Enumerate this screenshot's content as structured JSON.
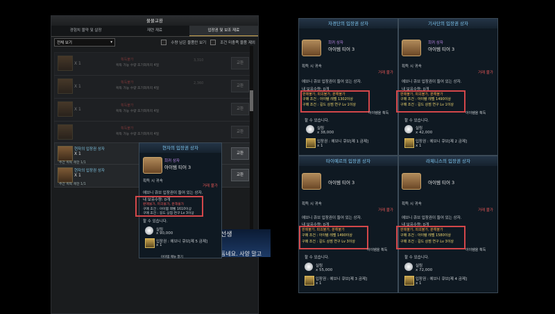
{
  "left": {
    "window_title": "물물교환",
    "tabs": [
      "경험치 물약 및 살장",
      "재련 재료",
      "입장권 및 보조 재료"
    ],
    "filter": {
      "dropdown": "전체 보기",
      "chk1": "수량 남은 물품만 보기",
      "chk2": "조건 미충족 물품 제외"
    },
    "rows": [
      {
        "na": "획득불가",
        "cond": "획득 가능 수량 초기화까지 4일",
        "qty": "3,310",
        "btn": "교환"
      },
      {
        "na": "획득불가",
        "cond": "획득 가능 수량 초기화까지 4일",
        "qty": "2,360",
        "btn": "교환"
      },
      {
        "na": "획득불가",
        "cond": "획득 가능 수량 초기화까지 4일",
        "qty": "",
        "btn": "교환"
      },
      {
        "na": "획득불가",
        "cond": "획득 가능 수량 초기화까지 4일",
        "qty": "",
        "btn": "교환"
      },
      {
        "name": "현자의 입장권 상자",
        "count": "X 1",
        "limit": "주간 획득 제한 1/1",
        "btn": "교환"
      },
      {
        "name": "현자의 입장권 상자",
        "count": "X 1",
        "limit": "주간 획득 제한 1/1",
        "btn": "교환"
      }
    ],
    "row_count_labels": [
      "X 1",
      "X 1",
      "X 1"
    ],
    "tooltip": {
      "title": "현자의 입장권 상자",
      "rarity": "희귀 상자",
      "tier": "아이템 티어 3",
      "bind": "획득 시 귀속",
      "trade": "거래 불가",
      "desc": "에브니 큐브 입장권이 들어 있는 상자.",
      "owned": "내 보유수량: 0개",
      "warn": "판매불가, 파괴불가, 분해불가",
      "cond1": "구매 조건 : 아이템 레벨 1610이상",
      "cond2": "구매 조건 : 길드 상점 연구 Lv 3이상",
      "can": "할 수 있습니다.",
      "silver_label": "실링",
      "silver_amt": "x 90,000",
      "ticket": "입장권 : 에브니 큐브[제 5 금제]",
      "ticket_qty": "x 1"
    },
    "hint": "아이템 메뉴 열기",
    "dialog_name": "선생",
    "dialog_text": "동네요. 사양 말고"
  },
  "tooltips": [
    {
      "title": "자경단의 입장권 상자",
      "rarity": "희귀 상자",
      "tier": "아이템 티어 3",
      "bind": "획득 시 귀속",
      "trade": "거래 불가",
      "desc": "에브니 큐브 입장권이 들어 있는 상자.",
      "owned": "내 보유수량: 0개",
      "warn": "판매불가, 파괴불가, 분해불가",
      "cond1": "구매 조건 : 아이템 레벨 1302이상",
      "cond2": "구매 조건 : 길드 상점 연구 Lv 1이상",
      "get": "아이템을 획득",
      "can": "할 수 있습니다.",
      "silver_label": "실링",
      "silver_amt": "x 38,000",
      "ticket": "입장권 : 에브니 큐브[제 1 금제]",
      "ticket_qty": "x 1"
    },
    {
      "title": "기사단의 입장권 상자",
      "rarity": "희귀 상자",
      "tier": "아이템 티어 3",
      "bind": "획득 시 귀속",
      "trade": "거래 불가",
      "desc": "에브니 큐브 입장권이 들어 있는 상자.",
      "owned": "내 보유수량: 0개",
      "warn": "판매불가, 파괴불가, 분해불가",
      "cond1": "구매 조건 : 아이템 레벨 1490이상",
      "cond2": "구매 조건 : 길드 상점 연구 Lv 1이상",
      "get": "아이템을 획득",
      "can": "할 수 있습니다.",
      "silver_label": "실링",
      "silver_amt": "x 42,000",
      "ticket": "입장권 : 에브니 큐브[제 2 금제]",
      "ticket_qty": "x 1"
    },
    {
      "title": "타이예르의 입장권 상자",
      "rarity": "희귀 상자",
      "tier": "아이템 티어 3",
      "bind": "획득 시 귀속",
      "trade": "거래 불가",
      "desc": "에브니 큐브 입장권이 들어 있는 상자.",
      "owned": "내 보유수량: 0개",
      "warn": "판매불가, 파괴불가, 분해불가",
      "cond1": "구매 조건 : 아이템 레벨 1490이상",
      "cond2": "구매 조건 : 길드 상점 연구 Lv 3이상",
      "get": "아이템을 획득",
      "can": "할 수 있습니다.",
      "silver_label": "실링",
      "silver_amt": "x 55,000",
      "ticket": "입장권 : 에브니 큐브[제 3 금제]",
      "ticket_qty": "x 1"
    },
    {
      "title": "라제니스의 입장권 상자",
      "rarity": "희귀 상자",
      "tier": "아이템 티어 3",
      "bind": "획득 시 귀속",
      "trade": "거래 불가",
      "desc": "에브니 큐브 입장권이 들어 있는 상자.",
      "owned": "내 보유수량: 0개",
      "warn": "판매불가, 파괴불가, 분해불가",
      "cond1": "구매 조건 : 아이템 레벨 1580이상",
      "cond2": "구매 조건 : 길드 상점 연구 Lv 3이상",
      "get": "아이템을 획득",
      "can": "할 수 있습니다.",
      "silver_label": "실링",
      "silver_amt": "x 72,000",
      "ticket": "입장권 : 에브니 큐브[제 4 금제]",
      "ticket_qty": "x 1"
    }
  ]
}
